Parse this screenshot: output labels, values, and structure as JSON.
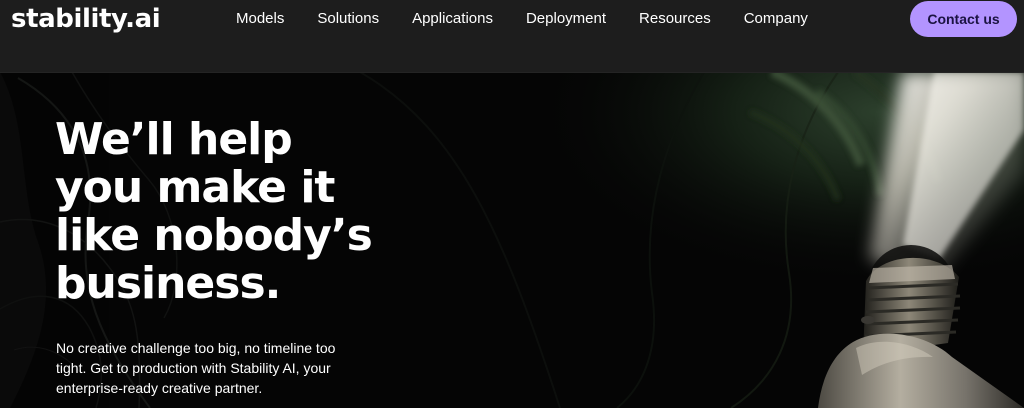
{
  "header": {
    "logo_text": "stability.ai",
    "nav": [
      {
        "label": "Models"
      },
      {
        "label": "Solutions"
      },
      {
        "label": "Applications"
      },
      {
        "label": "Deployment"
      },
      {
        "label": "Resources"
      },
      {
        "label": "Company"
      }
    ],
    "cta_label": "Contact us"
  },
  "hero": {
    "headline_lines": [
      "We’ll help",
      "you make it",
      "like nobody’s",
      "business."
    ],
    "subtext_lines": [
      "No creative challenge too big, no timeline too",
      "tight. Get to production with Stability AI, your",
      "enterprise-ready creative partner."
    ]
  },
  "colors": {
    "nav_background": "#1d1d1d",
    "hero_background": "#050505",
    "cta_background": "#b394ff",
    "cta_text": "#1b1341",
    "text": "#ffffff"
  }
}
